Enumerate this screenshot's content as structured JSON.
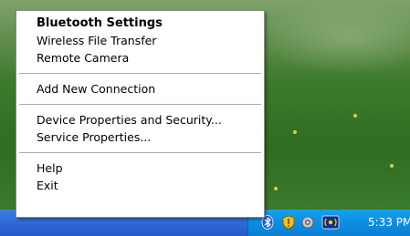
{
  "menu": {
    "items": [
      {
        "label": "Bluetooth Settings"
      },
      {
        "label": "Wireless File Transfer"
      },
      {
        "label": "Remote Camera"
      },
      {
        "label": "Add New Connection"
      },
      {
        "label": "Device Properties and Security..."
      },
      {
        "label": "Service Properties..."
      },
      {
        "label": "Help"
      },
      {
        "label": "Exit"
      }
    ]
  },
  "tray": {
    "icons": [
      "bluetooth-icon",
      "security-shield-icon",
      "volume-speaker-icon",
      "wireless-network-icon"
    ],
    "clock": "5:33 PM"
  },
  "colors": {
    "taskbar": "#2658c8",
    "tray": "#0c8de0",
    "menu_bg": "#ffffff"
  }
}
